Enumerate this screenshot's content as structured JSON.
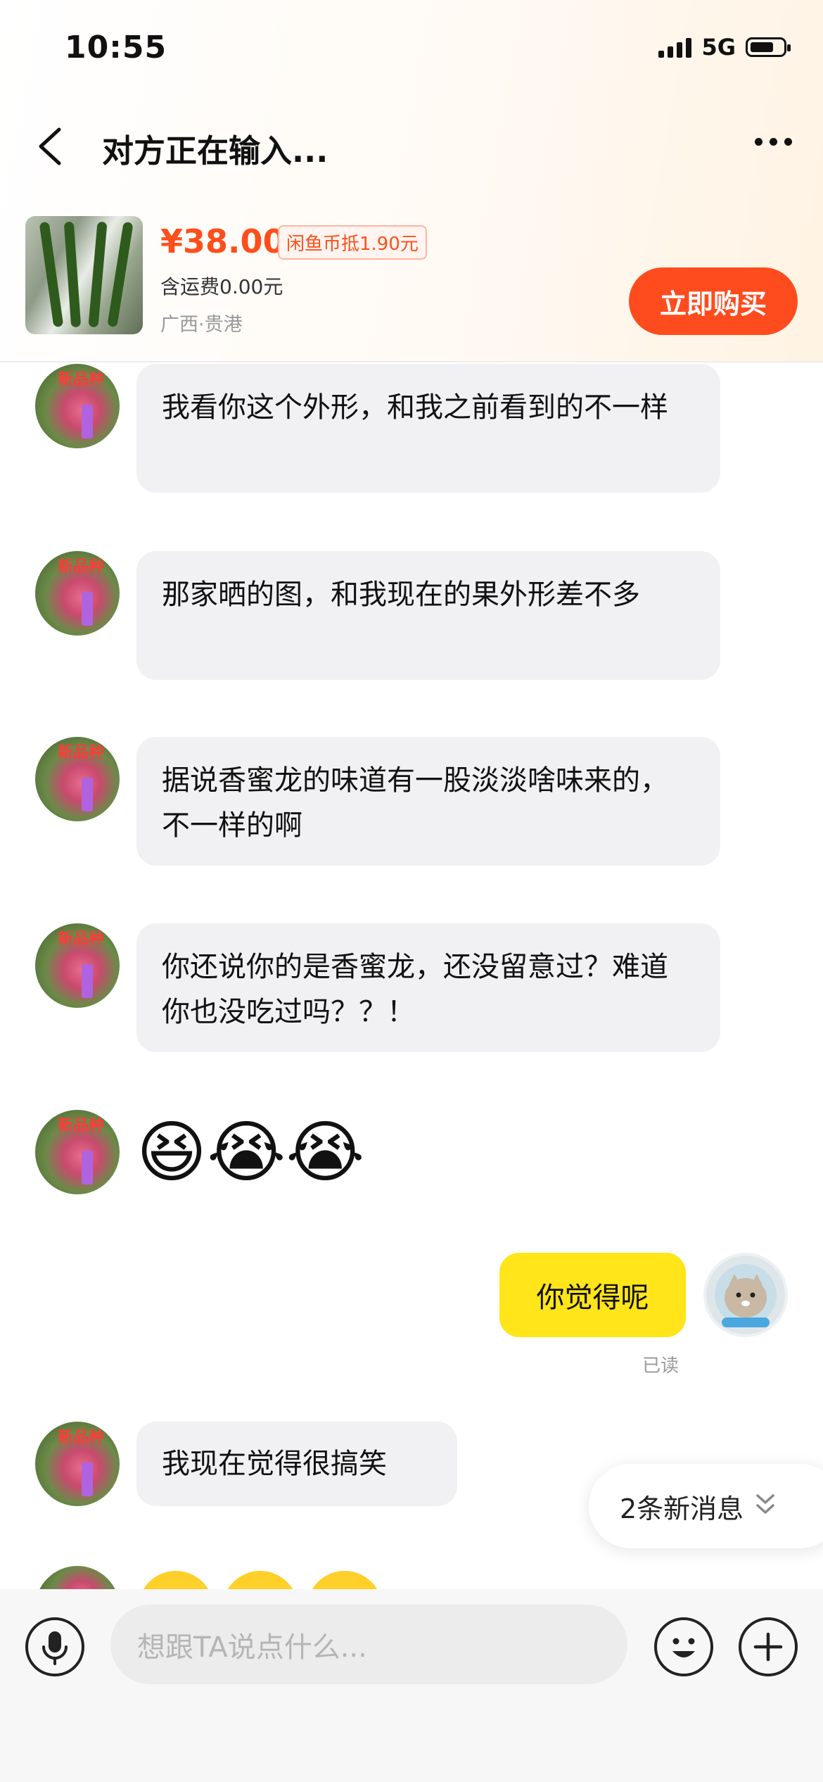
{
  "status_bar": {
    "time": "10:55",
    "network": "5G"
  },
  "header": {
    "title": "对方正在输入..."
  },
  "product": {
    "price": "¥38.00",
    "coin_discount": "闲鱼币抵1.90元",
    "shipping": "含运费0.00元",
    "location": "广西·贵港",
    "buy_label": "立即购买"
  },
  "messages": [
    {
      "from": "other",
      "text": "我看你这个外形，和我之前看到的不一样"
    },
    {
      "from": "other",
      "text": "那家晒的图，和我现在的果外形差不多"
    },
    {
      "from": "other",
      "text": "据说香蜜龙的味道有一股淡淡啥味来的，不一样的啊"
    },
    {
      "from": "other",
      "text": "你还说你的是香蜜龙，还没留意过？难道你也没吃过吗？？！"
    },
    {
      "from": "other",
      "emojis": "😆😭😭"
    },
    {
      "from": "me",
      "text": "你觉得呢",
      "status": "已读"
    },
    {
      "from": "other",
      "text": "我现在觉得很搞笑"
    }
  ],
  "new_messages_label": "2条新消息",
  "input": {
    "placeholder": "想跟TA说点什么..."
  },
  "colors": {
    "accent": "#ff4e1b",
    "my_bubble": "#ffe519",
    "other_bubble": "#f1f1f3"
  }
}
